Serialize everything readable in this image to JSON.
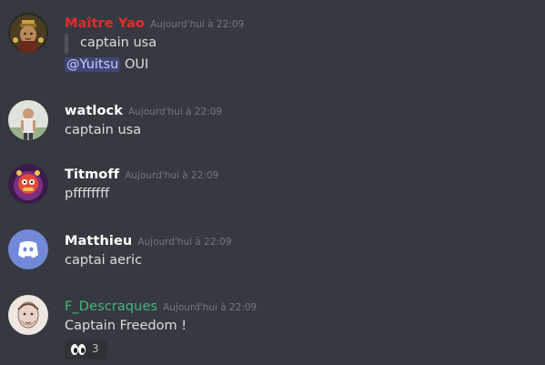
{
  "colors": {
    "background": "#36393f",
    "text": "#dcddde",
    "timestamp": "#72767d",
    "maitre_yao": "#e32b2b",
    "default_name": "#ffffff",
    "f_descraques": "#43b581",
    "discord_blurple": "#7289da"
  },
  "messages": [
    {
      "author": "Maître Yao",
      "timestamp": "Aujourd'hui à 22:09",
      "avatar_icon": "monk-avatar",
      "quote": "captain usa",
      "mention": "@Yuitsu",
      "text": "OUI"
    },
    {
      "author": "watlock",
      "timestamp": "Aujourd'hui à 22:09",
      "avatar_icon": "person-avatar",
      "text": "captain usa"
    },
    {
      "author": "Titmoff",
      "timestamp": "Aujourd'hui à 22:09",
      "avatar_icon": "cartoon-avatar",
      "text": "pffffffff"
    },
    {
      "author": "Matthieu",
      "timestamp": "Aujourd'hui à 22:09",
      "avatar_icon": "discord-logo-avatar",
      "text": "captai aeric"
    },
    {
      "author": "F_Descraques",
      "timestamp": "Aujourd'hui à 22:09",
      "avatar_icon": "sketch-avatar",
      "text": "Captain Freedom !",
      "reaction": {
        "emoji_icon": "eyes-emoji",
        "count": "3"
      }
    }
  ]
}
